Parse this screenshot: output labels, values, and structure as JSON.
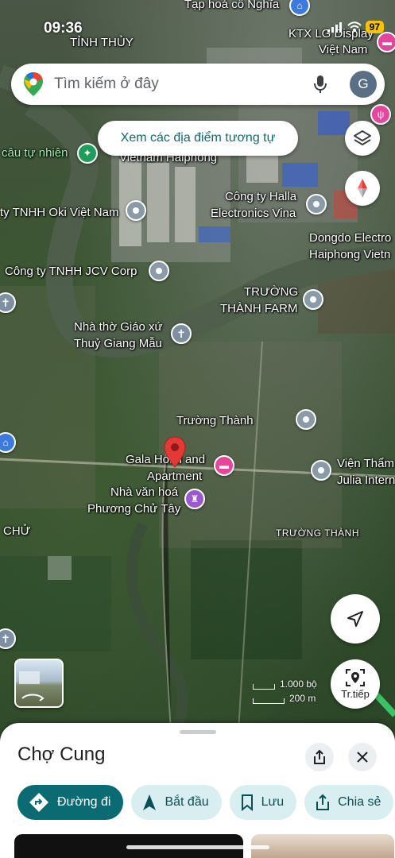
{
  "status": {
    "time": "09:36",
    "battery": "97"
  },
  "search": {
    "placeholder": "Tìm kiếm ở đây",
    "avatar_letter": "G"
  },
  "similar_places_label": "Xem các địa điểm tương tự",
  "map_labels": {
    "tap_hoa": "Tạp hoá cô Nghĩa",
    "tinh_thuy": "TỈNH THỦY",
    "ktx": "KTX LG Display",
    "ktx2": "Việt Nam",
    "cau_tu_nhien": "câu tự nhiên",
    "lg_vietnam": "Vietnam Haiphong",
    "halla1": "Công ty Halla",
    "halla2": "Electronics Vina",
    "oki": "ty TNHH Oki Việt Nam",
    "dongdo1": "Dongdo Electro",
    "dongdo2": "Haiphong Vietn",
    "jcv": "Công ty TNHH JCV Corp",
    "truong_thanh_farm1": "TRƯỜNG",
    "truong_thanh_farm2": "THÀNH FARM",
    "nha_tho1": "Nhà thờ Giáo xứ",
    "nha_tho2": "Thuỷ Giang Mẫu",
    "truong_thanh_poi": "Trường Thành",
    "gala1": "Gala Hotel and",
    "gala2": "Apartment",
    "vien_tham1": "Viện Thẩm",
    "vien_tham2": "Julia Intern",
    "nha_van_hoa1": "Nhà văn hoá",
    "nha_van_hoa2": "Phương Chử Tây",
    "chu": "CHỬ",
    "truong_thanh_area": "TRƯỜNG THÀNH"
  },
  "scale": {
    "top": "1.000 bộ",
    "bottom": "200 m"
  },
  "buttons": {
    "live_view": "Tr.tiếp"
  },
  "place": {
    "name": "Chợ Cung"
  },
  "actions": [
    {
      "label": "Đường đi",
      "icon": "directions-icon"
    },
    {
      "label": "Bắt đầu",
      "icon": "navigation-arrow-icon"
    },
    {
      "label": "Lưu",
      "icon": "bookmark-icon"
    },
    {
      "label": "Chia sẻ",
      "icon": "share-icon"
    }
  ],
  "colors": {
    "accent": "#0b6b72",
    "chip_bg": "#d9eef1",
    "pin_red": "#e53935",
    "battery": "#f4c400"
  }
}
